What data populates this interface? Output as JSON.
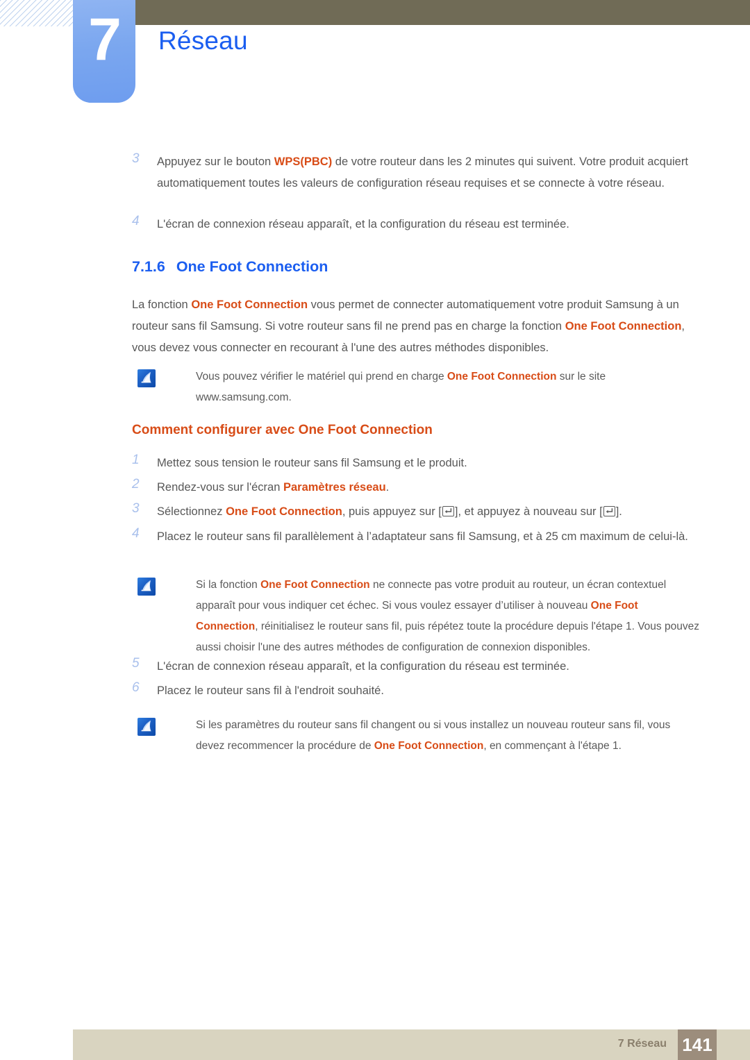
{
  "header": {
    "chapter_number": "7",
    "chapter_title": "Réseau",
    "topbar_color": "#706b56",
    "tab_color": "#7ba7ef",
    "title_color": "#1b5ef0"
  },
  "content": {
    "top_steps": [
      {
        "num": "3",
        "parts": [
          {
            "t": "Appuyez sur le bouton ",
            "hl": false
          },
          {
            "t": "WPS(PBC)",
            "hl": true
          },
          {
            "t": " de votre routeur dans les 2 minutes qui suivent. Votre produit acquiert automatiquement toutes les valeurs de configuration réseau requises et se connecte à votre réseau.",
            "hl": false
          }
        ]
      },
      {
        "num": "4",
        "parts": [
          {
            "t": "L'écran de connexion réseau apparaît, et la configuration du réseau est terminée.",
            "hl": false
          }
        ]
      }
    ],
    "section": {
      "number": "7.1.6",
      "title": "One Foot Connection"
    },
    "intro_paragraph": [
      {
        "t": "La fonction ",
        "hl": false
      },
      {
        "t": "One Foot Connection",
        "hl": true
      },
      {
        "t": " vous permet de connecter automatiquement votre produit Samsung à un routeur sans fil Samsung. Si votre routeur sans fil ne prend pas en charge la fonction ",
        "hl": false
      },
      {
        "t": "One Foot Connection",
        "hl": true
      },
      {
        "t": ", vous devez vous connecter en recourant à l'une des autres méthodes disponibles.",
        "hl": false
      }
    ],
    "note_1": [
      {
        "t": "Vous pouvez vérifier le matériel qui prend en charge ",
        "hl": false
      },
      {
        "t": "One Foot Connection",
        "hl": true
      },
      {
        "t": " sur le site www.samsung.com.",
        "hl": false
      }
    ],
    "sub_heading": "Comment configurer avec One Foot Connection",
    "steps": [
      {
        "num": "1",
        "parts": [
          {
            "t": "Mettez sous tension le routeur sans fil Samsung et le produit.",
            "hl": false
          }
        ]
      },
      {
        "num": "2",
        "parts": [
          {
            "t": "Rendez-vous sur l'écran ",
            "hl": false
          },
          {
            "t": "Paramètres réseau",
            "hl": true
          },
          {
            "t": ".",
            "hl": false
          }
        ]
      },
      {
        "num": "3",
        "parts": [
          {
            "t": "Sélectionnez ",
            "hl": false
          },
          {
            "t": "One Foot Connection",
            "hl": true
          },
          {
            "t": ", puis appuyez sur [",
            "hl": false
          },
          {
            "key": "enter-key"
          },
          {
            "t": "], et appuyez à nouveau sur [",
            "hl": false
          },
          {
            "key": "enter-key"
          },
          {
            "t": "].",
            "hl": false
          }
        ]
      },
      {
        "num": "4",
        "parts": [
          {
            "t": "Placez le routeur sans fil parallèlement à l’adaptateur sans fil Samsung, et à 25 cm maximum de celui-là.",
            "hl": false
          }
        ]
      }
    ],
    "note_2": [
      {
        "t": "Si la fonction ",
        "hl": false
      },
      {
        "t": "One Foot Connection",
        "hl": true
      },
      {
        "t": " ne connecte pas votre produit au routeur, un écran contextuel apparaît pour vous indiquer cet échec. Si vous voulez essayer d’utiliser à nouveau ",
        "hl": false
      },
      {
        "t": "One Foot Connection",
        "hl": true
      },
      {
        "t": ", réinitialisez le routeur sans fil, puis répétez toute la procédure depuis l'étape 1. Vous pouvez aussi choisir l'une des autres méthodes de configuration de connexion disponibles.",
        "hl": false
      }
    ],
    "steps_tail": [
      {
        "num": "5",
        "parts": [
          {
            "t": "L'écran de connexion réseau apparaît, et la configuration du réseau est terminée.",
            "hl": false
          }
        ]
      },
      {
        "num": "6",
        "parts": [
          {
            "t": "Placez le routeur sans fil à l'endroit souhaité.",
            "hl": false
          }
        ]
      }
    ],
    "note_3": [
      {
        "t": "Si les paramètres du routeur sans fil changent ou si vous installez un nouveau routeur sans fil, vous devez recommencer la procédure de ",
        "hl": false
      },
      {
        "t": "One Foot Connection",
        "hl": true
      },
      {
        "t": ", en commençant à l'étape 1.",
        "hl": false
      }
    ],
    "highlight_color": "#d84c17",
    "number_color": "#a9c0ec"
  },
  "footer": {
    "label": "7 Réseau",
    "page": "141",
    "bar_color": "#d9d4c0",
    "page_box_color": "#9c8d7c"
  }
}
